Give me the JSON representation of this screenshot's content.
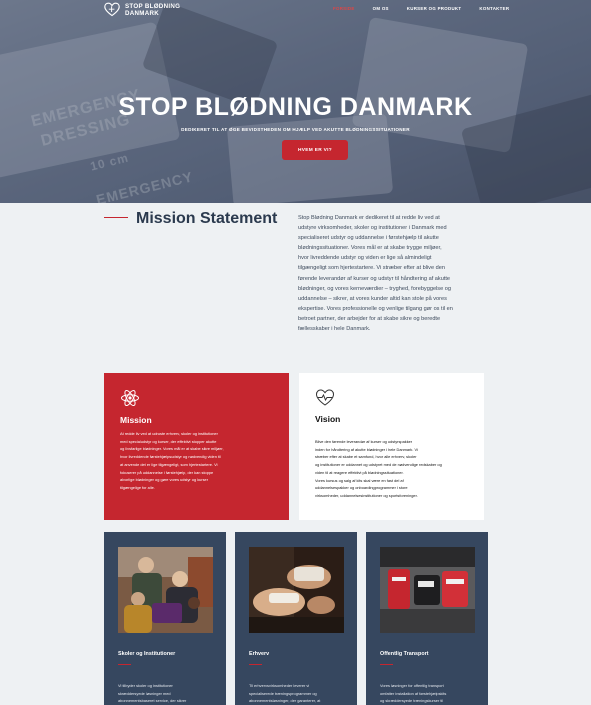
{
  "brand": {
    "name_line1": "STOP BLØDNING",
    "name_line2": "DANMARK"
  },
  "nav": {
    "items": [
      "FORSIDE",
      "OM OS",
      "KURSER OG PRODUKT",
      "KONTAKTER"
    ]
  },
  "hero": {
    "title": "STOP BLØDNING DANMARK",
    "subtitle": "DEDIKERET TIL AT ØGE BEVIDSTHEDEN OM HJÆLP VED AKUTTE BLØDNINGSSITUATIONER",
    "button": "HVEM ER VI?",
    "bg_text": [
      "EMERGENCY",
      "DRESSING",
      "10 cm",
      "EMERGENCY"
    ]
  },
  "mission_statement": {
    "title": "Mission Statement",
    "lines": [
      "Stop Blødning Danmark er dedikeret til at redde liv ved at",
      "udstyre virksomheder, skoler og institutioner i Danmark med",
      "specialiseret udstyr og uddannelse i førstehjælp til akutte",
      "blødningssituationer. Vores mål er at skabe trygge miljøer,",
      "hvor livreddende udstyr og viden er lige så almindeligt",
      "tilgængeligt som hjertestartere. Vi stræber efter at blive den",
      "førende leverandør af kurser og udstyr til håndtering af akutte",
      "blødninger, og vores kerneværdier – tryghed, forebyggelse og",
      "uddannelse – sikrer, at vores kunder altid kan stole på vores",
      "ekspertise. Vores professionelle og venlige tilgang gør os til en",
      "betroet partner, der arbejder for at skabe sikre og beredte",
      "fællesskaber i hele Danmark."
    ]
  },
  "cards": {
    "mission": {
      "title": "Mission",
      "lines": [
        "At redde liv ved at udruste erhverv, skoler og institutioner",
        "med specialudstyr og kurser, der effektivt stopper akutte",
        "og livsfarlige blødninger. Vores mål er at skabe sikre miljøer,",
        "hvor livreddende førstehjælpsudstyr og nødvendig viden til",
        "at anvende det er lige tilgængeligt, som hjertestartere. Vi",
        "fokuserer på uddannelse i førstehjælp, der kan stoppe",
        "alvorlige blødninger og gøre vores udstyr og kurser",
        "tilgængelige for alle."
      ]
    },
    "vision": {
      "title": "Vision",
      "lines": [
        "Blive den førende leverandør af kurser og udstyrspakker",
        "inden for håndtering af akutte blødninger i hele Danmark. Vi",
        "stræber efter at skabe et samfund, hvor alle erhverv, skoler",
        "og institutioner er uddannet og udstyret med de nødvendige redskaber og",
        "viden til at reagere effektivt på blødningssituationer.",
        "Vores kursus og salg af kits skal være en fast del af",
        "uddannelsespakker og onboardingprogrammer i store",
        "virksomheder, uddannelsesinstitutioner og sportsforeninger."
      ]
    }
  },
  "services": [
    {
      "title": "Skoler og Institutioner",
      "lines": [
        "Vi tilbyder skoler og institutioner",
        "skræddersyede løsninger med",
        "abonnementsbaseret service, der sikrer"
      ]
    },
    {
      "title": "Erhverv",
      "lines": [
        "Til erhvervsvirksomheder leverer vi",
        "specialiserede træningsprogrammer og",
        "abonnementsløsninger, der garanterer, at"
      ]
    },
    {
      "title": "Offentlig Transport",
      "lines": [
        "Vores løsninger for offentlig transport",
        "omfatter installation af førstehjælpskits",
        "og skræddersyede træningskurser til"
      ]
    }
  ],
  "colors": {
    "accent": "#c5262f",
    "navy": "#36475f",
    "bg": "#eef1f3"
  }
}
